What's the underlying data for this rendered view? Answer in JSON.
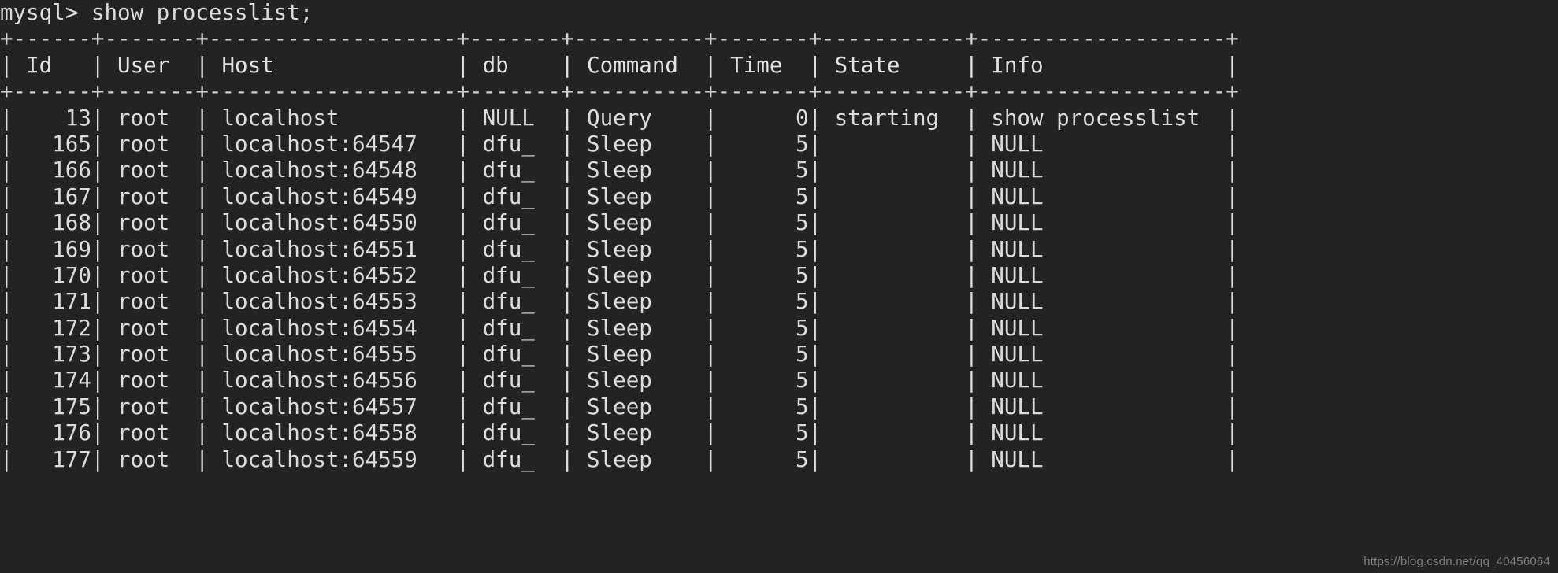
{
  "terminal": {
    "prompt": "mysql> ",
    "command": "show processlist;",
    "prompt_line": "mysql> show processlist;",
    "background_color": "#232323",
    "text_color": "#dcdcdc"
  },
  "table": {
    "columns": [
      {
        "name": "Id",
        "width": 5,
        "align": "right"
      },
      {
        "name": "User",
        "width": 6,
        "align": "left"
      },
      {
        "name": "Host",
        "width": 18,
        "align": "left"
      },
      {
        "name": "db",
        "width": 6,
        "align": "left"
      },
      {
        "name": "Command",
        "width": 9,
        "align": "left"
      },
      {
        "name": "Time",
        "width": 6,
        "align": "right"
      },
      {
        "name": "State",
        "width": 10,
        "align": "left"
      },
      {
        "name": "Info",
        "width": 18,
        "align": "left"
      }
    ],
    "rows": [
      {
        "Id": "13",
        "User": "root",
        "Host": "localhost",
        "db": "NULL",
        "Command": "Query",
        "Time": "0",
        "State": "starting",
        "Info": "show processlist"
      },
      {
        "Id": "165",
        "User": "root",
        "Host": "localhost:64547",
        "db": "dfu_",
        "Command": "Sleep",
        "Time": "5",
        "State": "",
        "Info": "NULL"
      },
      {
        "Id": "166",
        "User": "root",
        "Host": "localhost:64548",
        "db": "dfu_",
        "Command": "Sleep",
        "Time": "5",
        "State": "",
        "Info": "NULL"
      },
      {
        "Id": "167",
        "User": "root",
        "Host": "localhost:64549",
        "db": "dfu_",
        "Command": "Sleep",
        "Time": "5",
        "State": "",
        "Info": "NULL"
      },
      {
        "Id": "168",
        "User": "root",
        "Host": "localhost:64550",
        "db": "dfu_",
        "Command": "Sleep",
        "Time": "5",
        "State": "",
        "Info": "NULL"
      },
      {
        "Id": "169",
        "User": "root",
        "Host": "localhost:64551",
        "db": "dfu_",
        "Command": "Sleep",
        "Time": "5",
        "State": "",
        "Info": "NULL"
      },
      {
        "Id": "170",
        "User": "root",
        "Host": "localhost:64552",
        "db": "dfu_",
        "Command": "Sleep",
        "Time": "5",
        "State": "",
        "Info": "NULL"
      },
      {
        "Id": "171",
        "User": "root",
        "Host": "localhost:64553",
        "db": "dfu_",
        "Command": "Sleep",
        "Time": "5",
        "State": "",
        "Info": "NULL"
      },
      {
        "Id": "172",
        "User": "root",
        "Host": "localhost:64554",
        "db": "dfu_",
        "Command": "Sleep",
        "Time": "5",
        "State": "",
        "Info": "NULL"
      },
      {
        "Id": "173",
        "User": "root",
        "Host": "localhost:64555",
        "db": "dfu_",
        "Command": "Sleep",
        "Time": "5",
        "State": "",
        "Info": "NULL"
      },
      {
        "Id": "174",
        "User": "root",
        "Host": "localhost:64556",
        "db": "dfu_",
        "Command": "Sleep",
        "Time": "5",
        "State": "",
        "Info": "NULL"
      },
      {
        "Id": "175",
        "User": "root",
        "Host": "localhost:64557",
        "db": "dfu_",
        "Command": "Sleep",
        "Time": "5",
        "State": "",
        "Info": "NULL"
      },
      {
        "Id": "176",
        "User": "root",
        "Host": "localhost:64558",
        "db": "dfu_",
        "Command": "Sleep",
        "Time": "5",
        "State": "",
        "Info": "NULL"
      },
      {
        "Id": "177",
        "User": "root",
        "Host": "localhost:64559",
        "db": "dfu_",
        "Command": "Sleep",
        "Time": "5",
        "State": "",
        "Info": "NULL"
      }
    ]
  },
  "watermark": {
    "text": "https://blog.csdn.net/qq_40456064"
  }
}
